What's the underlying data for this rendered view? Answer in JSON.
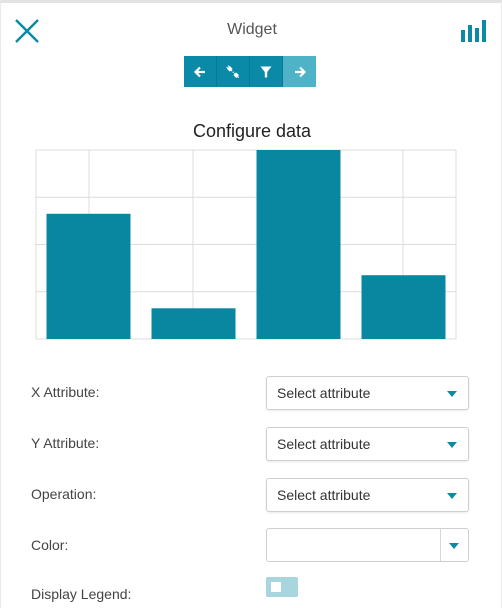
{
  "header": {
    "title": "Widget",
    "close_icon": "close-icon",
    "chart_type_icon": "bar-chart-icon"
  },
  "wizard": {
    "steps": [
      {
        "icon": "arrow-left-icon",
        "state": "active"
      },
      {
        "icon": "plug-icon",
        "state": "active"
      },
      {
        "icon": "filter-icon",
        "state": "active"
      },
      {
        "icon": "arrow-right-icon",
        "state": "light"
      }
    ],
    "accent": "#0a8aa6",
    "accent_light": "#4fb3c7"
  },
  "section_title": "Configure data",
  "chart_data": {
    "type": "bar",
    "title": "",
    "xlabel": "",
    "ylabel": "",
    "categories": [
      "",
      "",
      "",
      ""
    ],
    "values": [
      2.65,
      0.65,
      4.0,
      1.35
    ],
    "ylim": [
      0,
      4
    ],
    "grid": true,
    "legend": "none",
    "color": "#0a87a0"
  },
  "form": {
    "x_attribute": {
      "label": "X Attribute:",
      "value": "Select attribute"
    },
    "y_attribute": {
      "label": "Y Attribute:",
      "value": "Select attribute"
    },
    "operation": {
      "label": "Operation:",
      "value": "Select attribute"
    },
    "color": {
      "label": "Color:",
      "value": ""
    },
    "display_legend": {
      "label": "Display Legend:",
      "enabled": false
    }
  }
}
